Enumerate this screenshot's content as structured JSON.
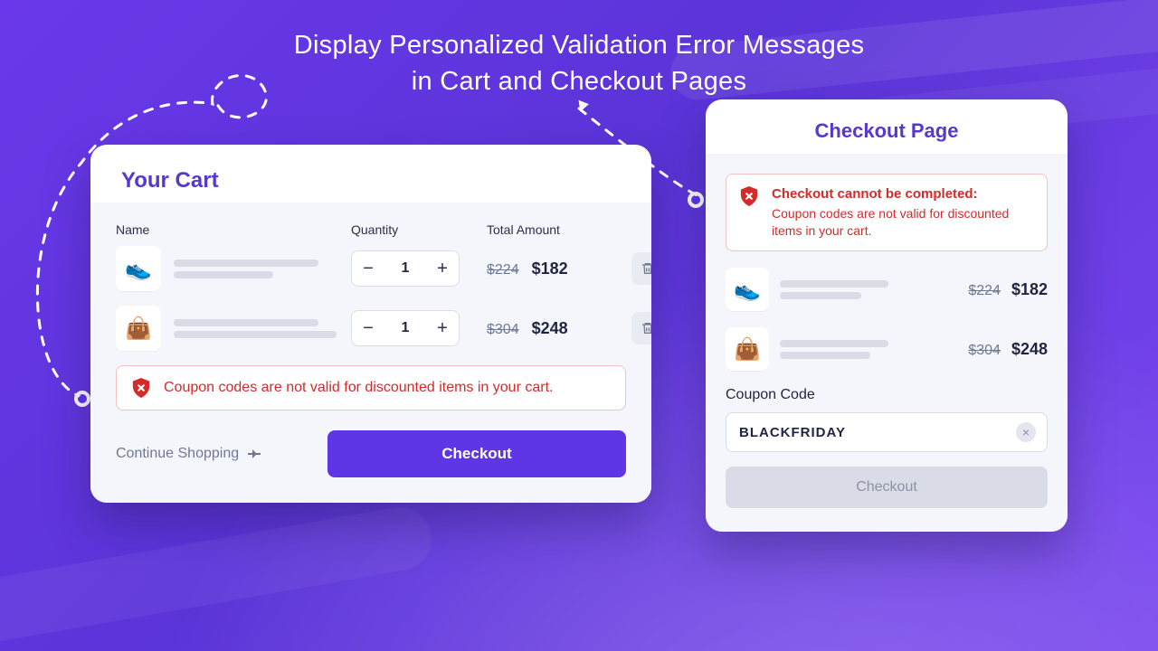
{
  "hero": {
    "title": "Display Personalized Validation Error Messages\nin Cart and Checkout Pages"
  },
  "cart": {
    "title": "Your Cart",
    "columns": {
      "name": "Name",
      "qty": "Quantity",
      "total": "Total Amount"
    },
    "items": [
      {
        "thumb_emoji": "👟",
        "qty": 1,
        "old_price": "$224",
        "new_price": "$182"
      },
      {
        "thumb_emoji": "👜",
        "qty": 1,
        "old_price": "$304",
        "new_price": "$248"
      }
    ],
    "error": "Coupon codes are not valid for discounted items in your cart.",
    "continue_label": "Continue Shopping",
    "checkout_label": "Checkout"
  },
  "checkout": {
    "title": "Checkout Page",
    "error_title": "Checkout cannot be completed:",
    "error_body": "Coupon codes are not valid for discounted items in your cart.",
    "items": [
      {
        "thumb_emoji": "👟",
        "old_price": "$224",
        "new_price": "$182"
      },
      {
        "thumb_emoji": "👜",
        "old_price": "$304",
        "new_price": "$248"
      }
    ],
    "coupon_label": "Coupon Code",
    "coupon_value": "BLACKFRIDAY",
    "checkout_label": "Checkout"
  },
  "icons": {
    "minus": "−",
    "plus": "+",
    "close": "×"
  },
  "colors": {
    "accent": "#5f36e6",
    "error": "#d52a2a"
  }
}
